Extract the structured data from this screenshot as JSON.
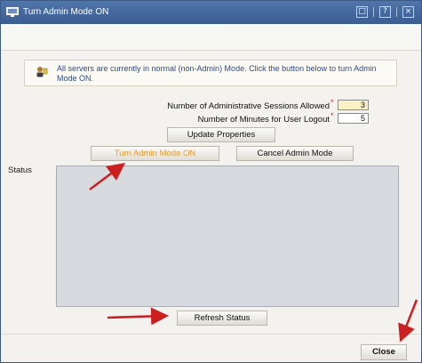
{
  "window": {
    "title": "Turn Admin Mode ON",
    "controls": [
      "□",
      "?",
      "×"
    ]
  },
  "info": {
    "text": "All servers are currently in normal (non-Admin) Mode. Click the button below to turn Admin Mode ON."
  },
  "form": {
    "sessions_label": "Number of Administrative Sessions Allowed",
    "sessions_value": "3",
    "minutes_label": "Number of Minutes for User Logout",
    "minutes_value": "5",
    "required_mark": "*"
  },
  "buttons": {
    "update_properties": "Update Properties",
    "turn_admin_on": "Turn Admin Mode ON",
    "cancel_admin": "Cancel Admin Mode",
    "refresh_status": "Refresh Status",
    "close": "Close"
  },
  "status": {
    "label": "Status"
  },
  "colors": {
    "title_bar": "#3a5d92",
    "info_text": "#2d4b8f",
    "turn_on_label": "#e59a2f",
    "annotation_arrow": "#cc1f1f",
    "status_bg": "#d7dbe0"
  }
}
